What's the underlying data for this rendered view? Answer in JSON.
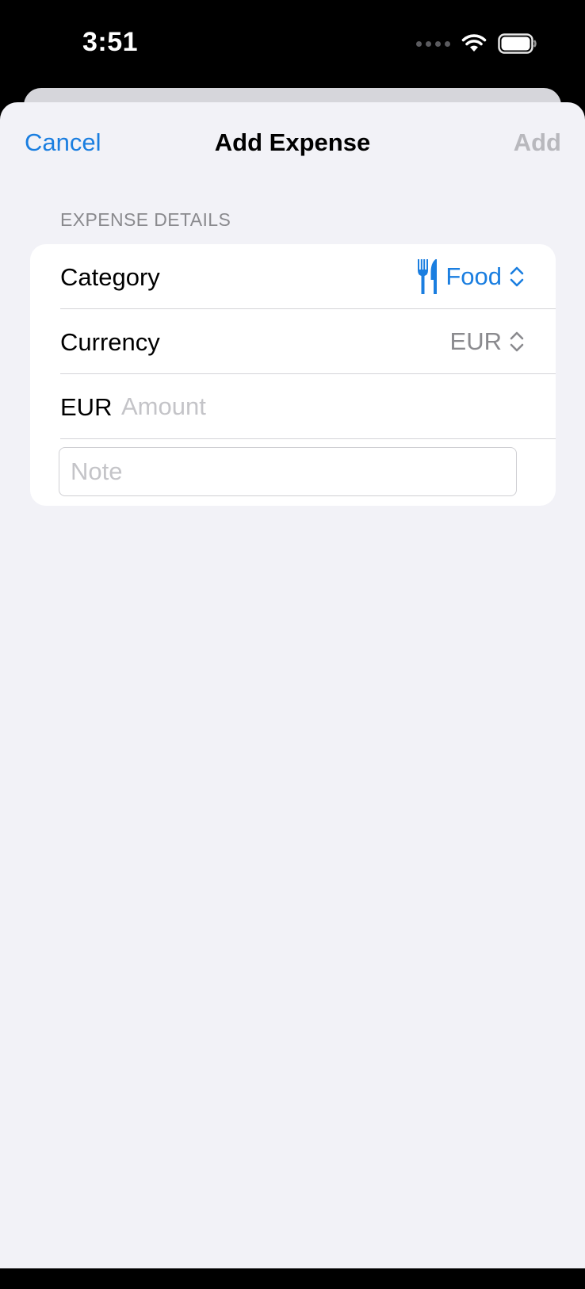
{
  "status_bar": {
    "time": "3:51",
    "icons": [
      "cellular-dots-icon",
      "wifi-icon",
      "battery-icon"
    ]
  },
  "nav": {
    "cancel_label": "Cancel",
    "title": "Add Expense",
    "add_label": "Add"
  },
  "form": {
    "section_title": "EXPENSE DETAILS",
    "category": {
      "label": "Category",
      "value": "Food",
      "icon": "fork-knife-icon"
    },
    "currency": {
      "label": "Currency",
      "value": "EUR"
    },
    "amount": {
      "currency_label": "EUR",
      "placeholder": "Amount",
      "value": ""
    },
    "note": {
      "placeholder": "Note",
      "value": ""
    }
  },
  "colors": {
    "accent": "#1a7ee0",
    "disabled": "#b8b8bd",
    "background": "#f2f2f7",
    "secondary_text": "#8a8a8e"
  }
}
